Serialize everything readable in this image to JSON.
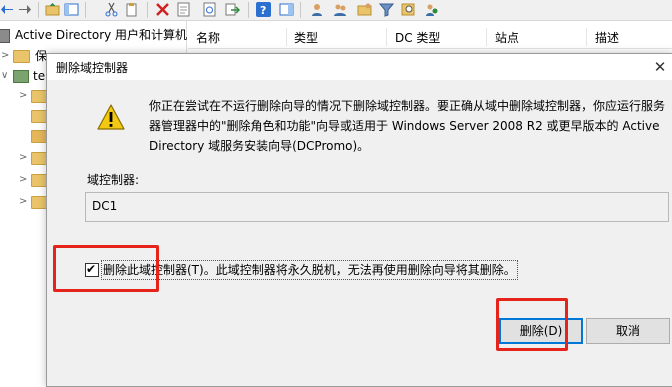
{
  "toolbar": {
    "icons": [
      "back-arrow-icon",
      "forward-arrow-icon",
      "up-folder-icon",
      "show-tree-icon",
      "cut-icon",
      "copy-icon",
      "delete-icon",
      "properties-icon",
      "refresh-icon",
      "export-icon",
      "help-icon",
      "action-pane-icon",
      "new-user-icon",
      "new-group-icon",
      "new-ou-icon",
      "filter-icon",
      "find-icon",
      "add-to-group-icon"
    ]
  },
  "tree": {
    "root_label": "Active Directory 用户和计算机",
    "saved_queries_label": "保",
    "domain_label": "te"
  },
  "list": {
    "columns": [
      "名称",
      "类型",
      "DC 类型",
      "站点",
      "描述"
    ]
  },
  "dialog": {
    "title": "删除域控制器",
    "message": "你正在尝试在不运行删除向导的情况下删除域控制器。要正确从域中删除域控制器，你应运行服务器管理器中的\"删除角色和功能\"向导或适用于 Windows Server 2008 R2 或更早版本的 Active Directory 域服务安装向导(DCPromo)。",
    "dc_label": "域控制器:",
    "dc_value": "DC1",
    "confirm_checked": true,
    "confirm_label": "删除此域控制器(T)。此域控制器将永久脱机，无法再使用删除向导将其删除。",
    "delete_button": "删除(D)",
    "cancel_button": "取消",
    "close_glyph": "✕"
  },
  "colors": {
    "highlight": "#e5231b",
    "default_button_border": "#0078d7",
    "warning_fill": "#f2c811"
  }
}
